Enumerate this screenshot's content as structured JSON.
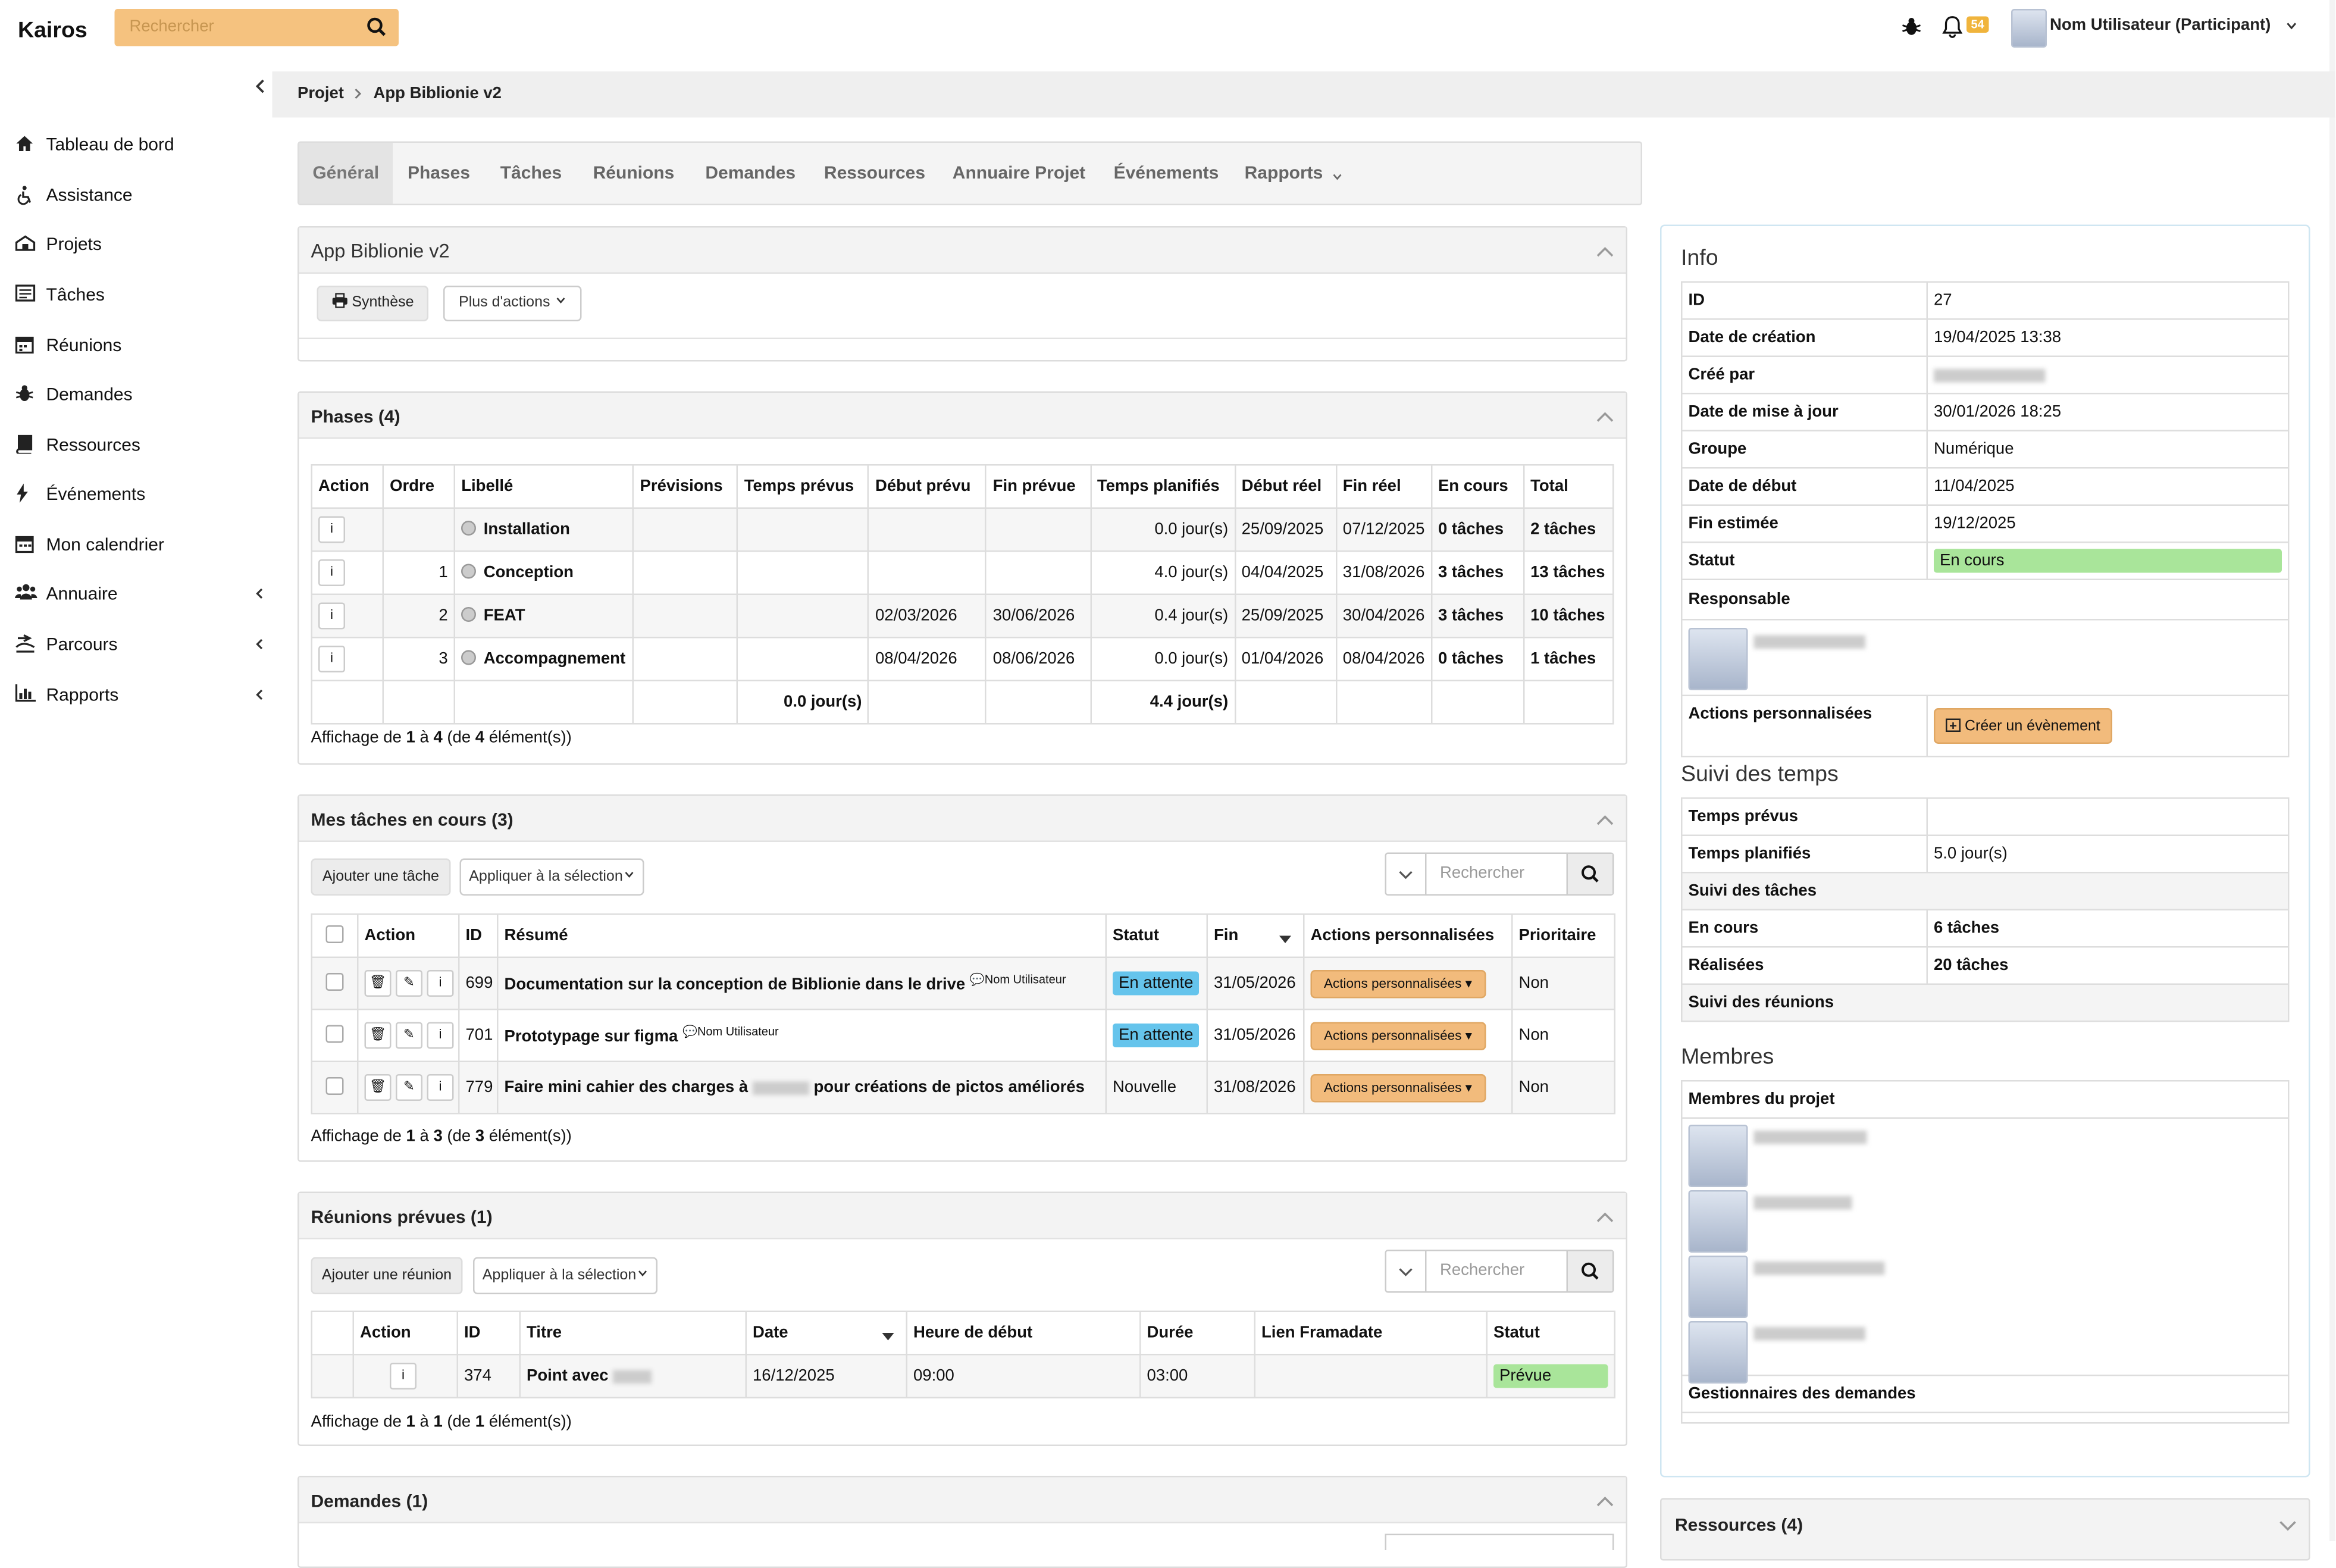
{
  "header": {
    "brand": "Kairos",
    "search_placeholder": "Rechercher",
    "notif_count": "54",
    "user_name": "Nom Utilisateur (Participant)"
  },
  "sidebar": {
    "items": [
      {
        "label": "Tableau de bord",
        "icon": "home-icon"
      },
      {
        "label": "Assistance",
        "icon": "accessibility-icon"
      },
      {
        "label": "Projets",
        "icon": "projects-icon"
      },
      {
        "label": "Tâches",
        "icon": "tasks-icon"
      },
      {
        "label": "Réunions",
        "icon": "calendar-icon"
      },
      {
        "label": "Demandes",
        "icon": "bug-icon"
      },
      {
        "label": "Ressources",
        "icon": "book-icon"
      },
      {
        "label": "Événements",
        "icon": "bolt-icon"
      },
      {
        "label": "Mon calendrier",
        "icon": "calendar-icon"
      },
      {
        "label": "Annuaire",
        "icon": "users-icon"
      },
      {
        "label": "Parcours",
        "icon": "route-icon"
      },
      {
        "label": "Rapports",
        "icon": "chart-icon"
      }
    ]
  },
  "breadcrumb": {
    "root": "Projet",
    "current": "App Biblionie v2"
  },
  "tabs": [
    "Général",
    "Phases",
    "Tâches",
    "Réunions",
    "Demandes",
    "Ressources",
    "Annuaire Projet",
    "Événements",
    "Rapports"
  ],
  "project_panel": {
    "title": "App Biblionie v2",
    "synthese": "Synthèse",
    "more_actions": "Plus d'actions"
  },
  "phases": {
    "title": "Phases (4)",
    "headers": [
      "Action",
      "Ordre",
      "Libellé",
      "Prévisions",
      "Temps prévus",
      "Début prévu",
      "Fin prévue",
      "Temps planifiés",
      "Début réel",
      "Fin réel",
      "En cours",
      "Total"
    ],
    "rows": [
      {
        "ordre": "",
        "libelle": "Installation",
        "prev": "",
        "temps_prevus": "",
        "debut_prevu": "",
        "fin_prevue": "",
        "temps_planifies": "0.0 jour(s)",
        "debut_reel": "25/09/2025",
        "fin_reel": "07/12/2025",
        "en_cours": "0 tâches",
        "total": "2 tâches"
      },
      {
        "ordre": "1",
        "libelle": "Conception",
        "prev": "",
        "temps_prevus": "",
        "debut_prevu": "",
        "fin_prevue": "",
        "temps_planifies": "4.0 jour(s)",
        "debut_reel": "04/04/2025",
        "fin_reel": "31/08/2026",
        "en_cours": "3 tâches",
        "total": "13 tâches"
      },
      {
        "ordre": "2",
        "libelle": "FEAT",
        "prev": "",
        "temps_prevus": "",
        "debut_prevu": "02/03/2026",
        "fin_prevue": "30/06/2026",
        "temps_planifies": "0.4 jour(s)",
        "debut_reel": "25/09/2025",
        "fin_reel": "30/04/2026",
        "en_cours": "3 tâches",
        "total": "10 tâches"
      },
      {
        "ordre": "3",
        "libelle": "Accompagnement",
        "prev": "",
        "temps_prevus": "",
        "debut_prevu": "08/04/2026",
        "fin_prevue": "08/06/2026",
        "temps_planifies": "0.0 jour(s)",
        "debut_reel": "01/04/2026",
        "fin_reel": "08/04/2026",
        "en_cours": "0 tâches",
        "total": "1 tâches"
      }
    ],
    "total_prevus": "0.0 jour(s)",
    "total_planifies": "4.4 jour(s)",
    "footer": {
      "pre": "Affichage de ",
      "a": "1",
      "mid1": " à ",
      "b": "4",
      "mid2": " (de ",
      "c": "4",
      "post": " élément(s))"
    }
  },
  "taches": {
    "title": "Mes tâches en cours (3)",
    "add": "Ajouter une tâche",
    "apply": "Appliquer à la sélection",
    "search": "Rechercher",
    "headers": [
      "Action",
      "ID",
      "Résumé",
      "Statut",
      "Fin",
      "Actions personnalisées",
      "Prioritaire"
    ],
    "rows": [
      {
        "id": "699",
        "resume": "Documentation sur la conception de Biblionie dans le drive",
        "comment": "Nom Utilisateur",
        "statut": "En attente",
        "fin": "31/05/2026",
        "action": "Actions personnalisées",
        "prio": "Non"
      },
      {
        "id": "701",
        "resume": "Prototypage sur figma",
        "comment": "Nom Utilisateur",
        "statut": "En attente",
        "fin": "31/05/2026",
        "action": "Actions personnalisées",
        "prio": "Non"
      },
      {
        "id": "779",
        "resume_pre": "Faire mini cahier des charges à",
        "resume_post": "pour créations de pictos améliorés",
        "statut": "Nouvelle",
        "fin": "31/08/2026",
        "action": "Actions personnalisées",
        "prio": "Non"
      }
    ],
    "footer": {
      "pre": "Affichage de ",
      "a": "1",
      "mid1": " à ",
      "b": "3",
      "mid2": " (de ",
      "c": "3",
      "post": " élément(s))"
    }
  },
  "reunions": {
    "title": "Réunions prévues (1)",
    "add": "Ajouter une réunion",
    "apply": "Appliquer à la sélection",
    "search": "Rechercher",
    "headers": [
      "Action",
      "ID",
      "Titre",
      "Date",
      "Heure de début",
      "Durée",
      "Lien Framadate",
      "Statut"
    ],
    "rows": [
      {
        "id": "374",
        "titre": "Point avec",
        "date": "16/12/2025",
        "heure": "09:00",
        "duree": "03:00",
        "lien": "",
        "statut": "Prévue"
      }
    ],
    "footer": {
      "pre": "Affichage de ",
      "a": "1",
      "mid1": " à ",
      "b": "1",
      "mid2": " (de ",
      "c": "1",
      "post": " élément(s))"
    }
  },
  "demandes": {
    "title": "Demandes (1)"
  },
  "info": {
    "title": "Info",
    "rows": [
      {
        "k": "ID",
        "v": "27"
      },
      {
        "k": "Date de création",
        "v": "19/04/2025 13:38"
      },
      {
        "k": "Créé par",
        "v": ""
      },
      {
        "k": "Date de mise à jour",
        "v": "30/01/2026 18:25"
      },
      {
        "k": "Groupe",
        "v": "Numérique"
      },
      {
        "k": "Date de début",
        "v": "11/04/2025"
      },
      {
        "k": "Fin estimée",
        "v": "19/12/2025"
      }
    ],
    "statut_label": "Statut",
    "statut": "En cours",
    "responsable": "Responsable",
    "actions_label": "Actions personnalisées",
    "create_event": "Créer un évènement"
  },
  "suivi": {
    "title": "Suivi des temps",
    "temps_prevus": "Temps prévus",
    "temps_prevus_v": "",
    "temps_planifies": "Temps planifiés",
    "temps_planifies_v": "5.0 jour(s)",
    "suivi_taches": "Suivi des tâches",
    "en_cours": "En cours",
    "en_cours_v": "6 tâches",
    "realisees": "Réalisées",
    "realisees_v": "20 tâches",
    "suivi_reunions": "Suivi des réunions"
  },
  "membres": {
    "title": "Membres",
    "membres_projet": "Membres du projet",
    "gestionnaires": "Gestionnaires des demandes"
  },
  "ressources": {
    "title": "Ressources (4)"
  },
  "colors": {
    "accent_orange": "#f5c27f",
    "status_green": "#a9e59a",
    "status_blue": "#65c4ec",
    "notif_badge": "#f0b43c"
  }
}
